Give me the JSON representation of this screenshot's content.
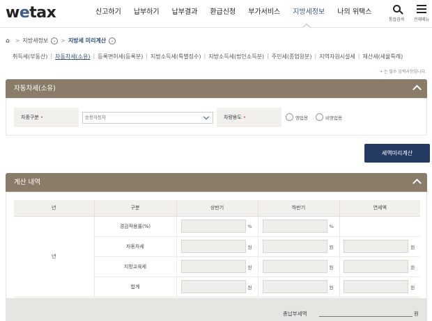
{
  "header": {
    "logo": {
      "part1": "w",
      "part2": "e",
      "part3": "tax"
    },
    "nav": [
      "신고하기",
      "납부하기",
      "납부결과",
      "환급신청",
      "부가서비스",
      "지방세정보",
      "나의 위택스"
    ],
    "active_nav": "지방세정보",
    "search_label": "통합검색",
    "menu_label": "전체메뉴"
  },
  "breadcrumb": {
    "home_icon": "home-icon",
    "level1": "지방세정보",
    "level2": "지방세 미리계산"
  },
  "tabs": [
    {
      "label": "취득세(부동산)",
      "active": false
    },
    {
      "label": "자동차세(소유)",
      "active": true
    },
    {
      "label": "등록면허세(등록분)",
      "active": false
    },
    {
      "label": "지방소득세(특별징수)",
      "active": false
    },
    {
      "label": "지방소득세(법인소득분)",
      "active": false
    },
    {
      "label": "주민세(종업원분)",
      "active": false
    },
    {
      "label": "지역자원시설세",
      "active": false
    },
    {
      "label": "재산세(세율특례)",
      "active": false
    }
  ],
  "required_note": "는 필수 입력사항입니다.",
  "vehicle_panel": {
    "title": "자동차세(소유)",
    "vehicle_type_label": "차종구분",
    "vehicle_type_value": "승용자동차",
    "usage_label": "차량용도",
    "usage_options": [
      "영업용",
      "비영업용"
    ],
    "calc_button": "세액미리계산"
  },
  "result_panel": {
    "title": "계산 내역",
    "columns": [
      "년",
      "구분",
      "상반기",
      "하반기",
      "연세액"
    ],
    "year_value": "년",
    "rows": [
      {
        "label": "경감적용률(%)",
        "unit": "%"
      },
      {
        "label": "자동차세",
        "unit": "원"
      },
      {
        "label": "지방교육세",
        "unit": "원"
      },
      {
        "label": "합계",
        "unit": "원"
      }
    ],
    "total_label": "총납부세액",
    "total_unit": "원"
  },
  "colors": {
    "panel_header": "#8b7c69",
    "primary_button": "#253a62",
    "accent_blue": "#3d5c86",
    "required_mark": "#e05a2a"
  }
}
